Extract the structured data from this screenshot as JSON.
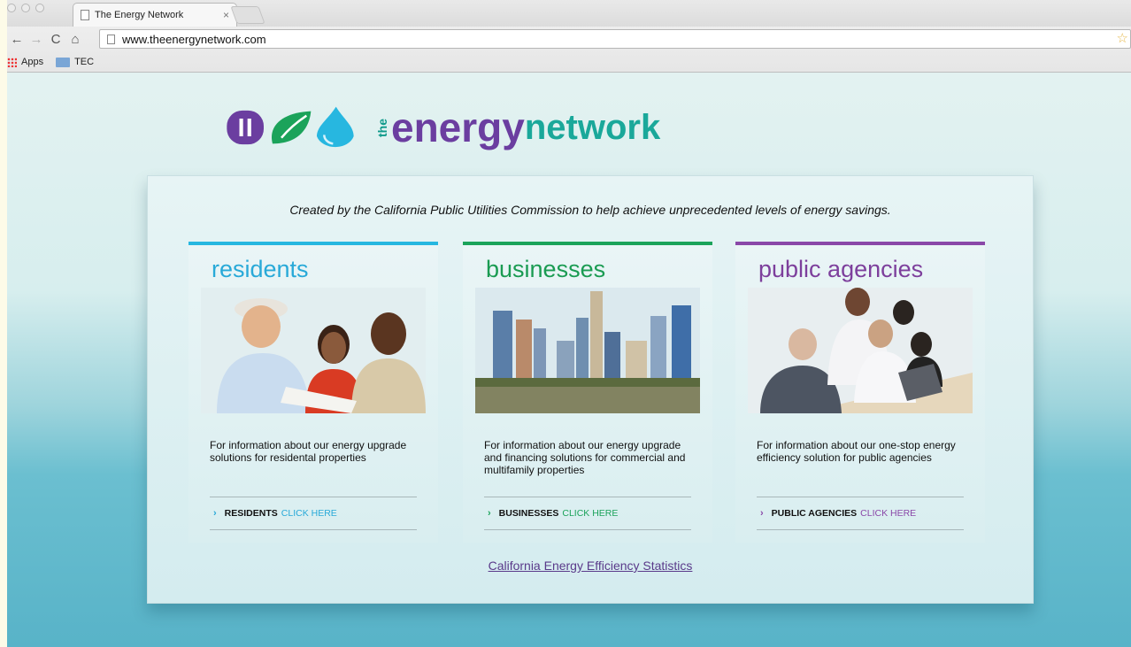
{
  "browser": {
    "tab_title": "The Energy Network",
    "tab_close": "×",
    "url": "www.theenergynetwork.com",
    "bookmarks": [
      {
        "label": "Apps",
        "icon": "apps-grid-icon"
      },
      {
        "label": "TEC",
        "icon": "folder-icon"
      }
    ],
    "icons": {
      "back": "←",
      "forward": "→",
      "reload": "C",
      "home": "⌂",
      "star": "☆"
    }
  },
  "logo": {
    "the": "the",
    "word1": "energy",
    "word2": "network",
    "colors": {
      "purple": "#6b3ea0",
      "green": "#1ba35a",
      "blue": "#27b7e0",
      "teal": "#1aa89a"
    }
  },
  "tagline": "Created by the California Public Utilities Commission to help achieve unprecedented levels of energy savings.",
  "cards": [
    {
      "heading": "residents",
      "accent": "#27b7e0",
      "description": "For information about our energy upgrade solutions for residental properties",
      "link_label": "RESIDENTS",
      "link_cta": "CLICK HERE"
    },
    {
      "heading": "businesses",
      "accent": "#1ba35a",
      "description": "For information about our energy upgrade and financing solutions for commercial and multifamily properties",
      "link_label": "BUSINESSES",
      "link_cta": "CLICK HERE"
    },
    {
      "heading": "public agencies",
      "accent": "#8a48a8",
      "description": "For information about our one-stop energy efficiency solution for public agencies",
      "link_label": "PUBLIC AGENCIES",
      "link_cta": "CLICK HERE"
    }
  ],
  "chevron": "›",
  "stats_link": "California Energy Efficiency Statistics"
}
